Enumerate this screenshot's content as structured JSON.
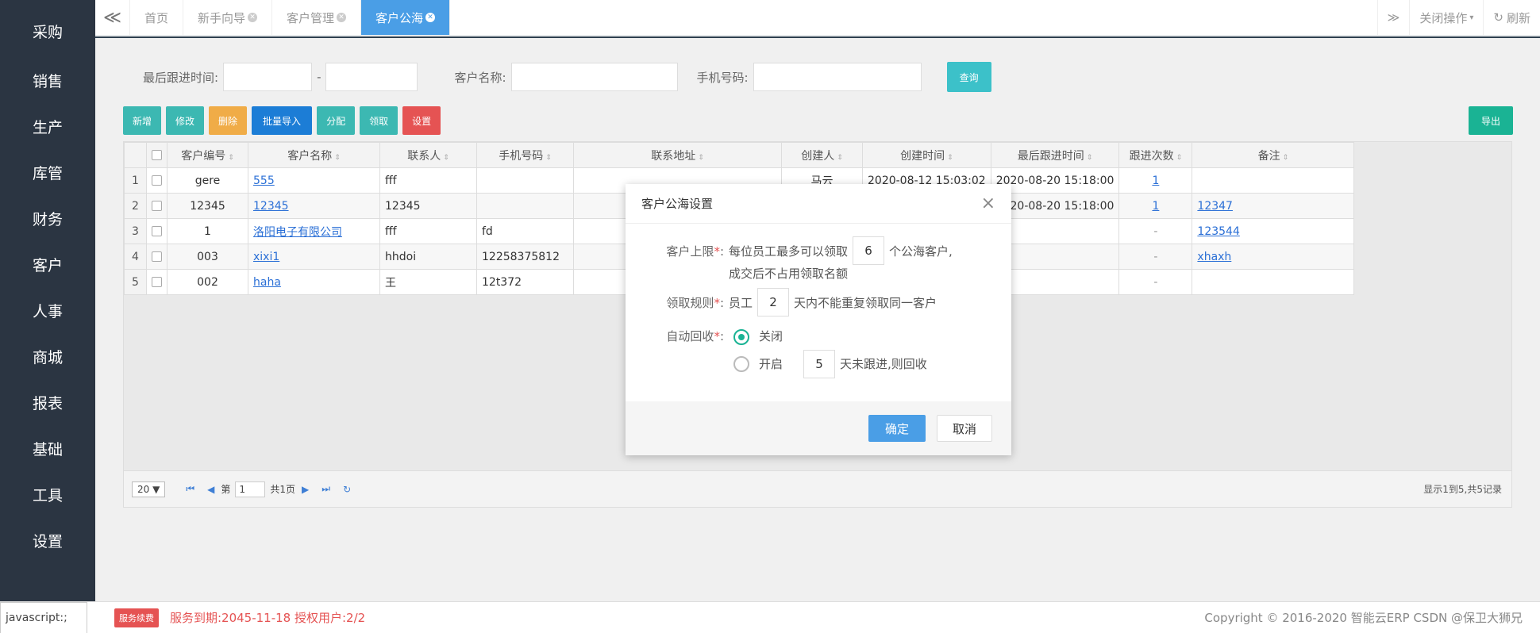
{
  "sidebar": {
    "items": [
      {
        "label": "采购"
      },
      {
        "label": "销售"
      },
      {
        "label": "生产"
      },
      {
        "label": "库管"
      },
      {
        "label": "财务"
      },
      {
        "label": "客户"
      },
      {
        "label": "人事"
      },
      {
        "label": "商城"
      },
      {
        "label": "报表"
      },
      {
        "label": "基础"
      },
      {
        "label": "工具"
      },
      {
        "label": "设置"
      }
    ]
  },
  "topbar": {
    "left_arrow": "≪",
    "tabs": [
      {
        "label": "首页"
      },
      {
        "label": "新手向导"
      },
      {
        "label": "客户管理"
      },
      {
        "label": "客户公海"
      }
    ],
    "right_arrow": "≫",
    "close_ops": "关闭操作",
    "refresh": "刷新"
  },
  "filters": {
    "last_follow_label": "最后跟进时间:",
    "date_sep": "-",
    "customer_name_label": "客户名称:",
    "phone_label": "手机号码:",
    "query_btn": "查询"
  },
  "toolbar": {
    "add": "新增",
    "edit": "修改",
    "delete": "删除",
    "batch_import": "批量导入",
    "assign": "分配",
    "claim": "领取",
    "settings": "设置",
    "export": "导出"
  },
  "table": {
    "headers": [
      "客户编号",
      "客户名称",
      "联系人",
      "手机号码",
      "联系地址",
      "创建人",
      "创建时间",
      "最后跟进时间",
      "跟进次数",
      "备注"
    ],
    "rows": [
      {
        "no": "1",
        "code": "gere",
        "name": "555",
        "contact": "fff",
        "phone": "",
        "address": "",
        "creator": "马云",
        "created": "2020-08-12 15:03:02",
        "last": "2020-08-20 15:18:00",
        "count": "1",
        "remark": ""
      },
      {
        "no": "2",
        "code": "12345",
        "name": "12345",
        "contact": "12345",
        "phone": "",
        "address": "",
        "creator": "",
        "created": "",
        "last": "2020-08-20 15:18:00",
        "count": "1",
        "remark": "12347"
      },
      {
        "no": "3",
        "code": "1",
        "name": "洛阳电子有限公司",
        "contact": "fff",
        "phone": "fd",
        "address": "",
        "creator": "",
        "created": "",
        "last": "",
        "count": "-",
        "remark": "123544"
      },
      {
        "no": "4",
        "code": "003",
        "name": "xixi1",
        "contact": "hhdoi",
        "phone": "12258375812",
        "address": "",
        "creator": "",
        "created": "",
        "last": "",
        "count": "-",
        "remark": "xhaxh"
      },
      {
        "no": "5",
        "code": "002",
        "name": "haha",
        "contact": "王",
        "phone": "12t372",
        "address": "",
        "creator": "",
        "created": "",
        "last": "",
        "count": "-",
        "remark": ""
      }
    ]
  },
  "pager": {
    "page_size": "20 ▼",
    "page_prefix": "第",
    "page_value": "1",
    "page_total": "共1页",
    "summary": "显示1到5,共5记录"
  },
  "modal": {
    "title": "客户公海设置",
    "limit_label": "客户上限",
    "limit_pre": "每位员工最多可以领取",
    "limit_value": "6",
    "limit_post": "个公海客户,",
    "limit_note": "成交后不占用领取名额",
    "rule_label": "领取规则",
    "rule_pre": "员工",
    "rule_value": "2",
    "rule_post": "天内不能重复领取同一客户",
    "recycle_label": "自动回收",
    "opt_off": "关闭",
    "opt_on": "开启",
    "recycle_days": "5",
    "recycle_post": "天未跟进,则回收",
    "ok": "确定",
    "cancel": "取消"
  },
  "footer": {
    "js_status": "javascript:;",
    "service_badge": "服务续费",
    "service_text": "服务到期:2045-11-18 授权用户:2/2",
    "copyright": "Copyright © 2016-2020 智能云ERP CSDN @保卫大狮兄"
  },
  "colors": {
    "sidebar_bg": "#2b3542",
    "active_tab": "#4a9ee6",
    "teal_btn": "#3cb8b2",
    "orange_btn": "#f0ac47",
    "blue_btn": "#1c7dd6",
    "red_btn": "#e55353",
    "export_btn": "#1ab394"
  }
}
